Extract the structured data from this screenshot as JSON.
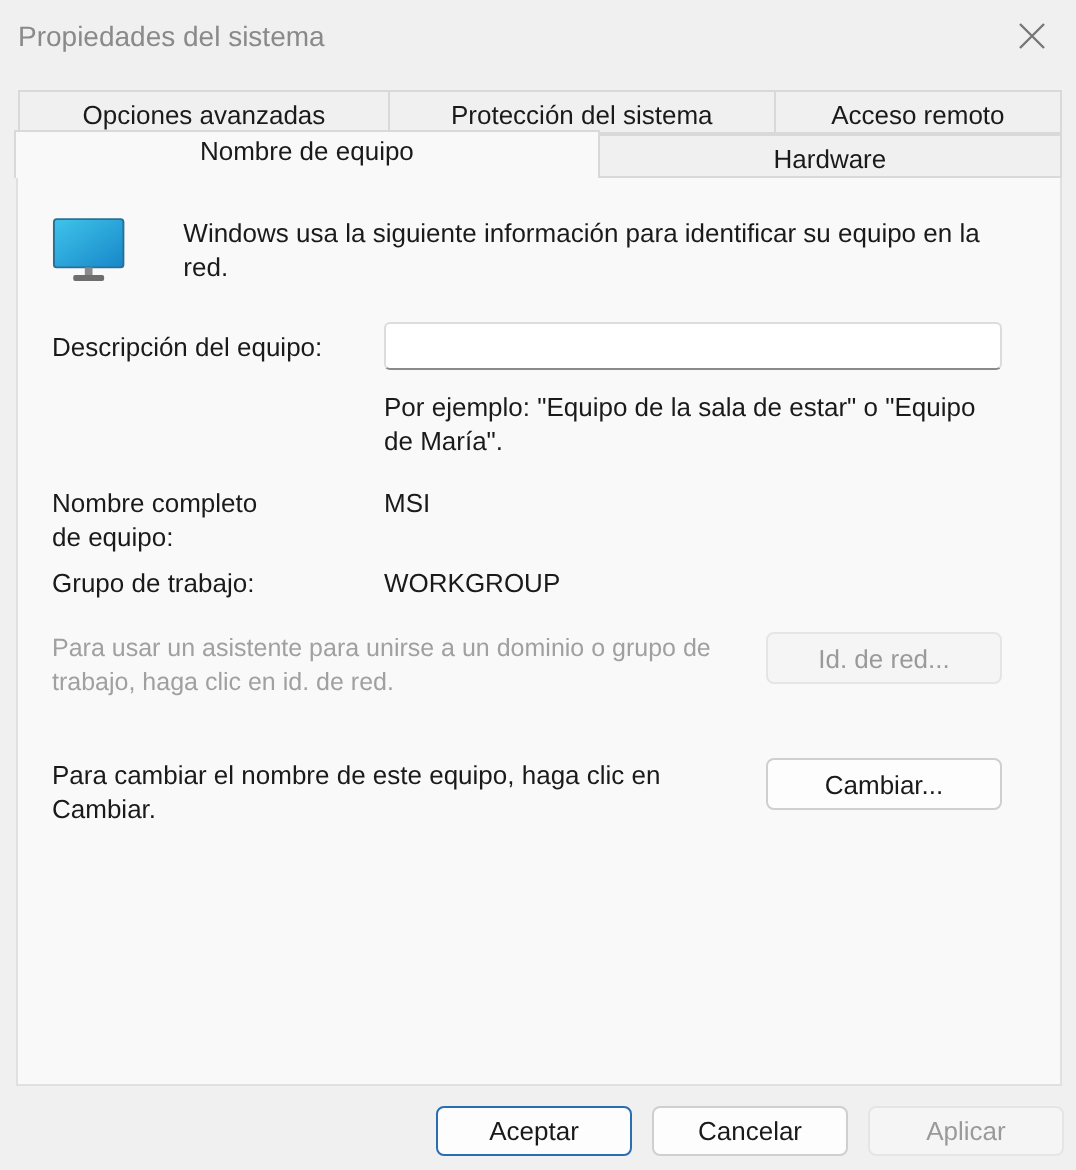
{
  "window": {
    "title": "Propiedades del sistema"
  },
  "tab_rows": [
    {
      "tabs": [
        {
          "label": "Opciones avanzadas",
          "selected": false
        },
        {
          "label": "Protección del sistema",
          "selected": false
        },
        {
          "label": "Acceso remoto",
          "selected": false
        }
      ]
    },
    {
      "tabs": [
        {
          "label": "Nombre de equipo",
          "selected": true
        },
        {
          "label": "Hardware",
          "selected": false
        }
      ]
    }
  ],
  "panel": {
    "intro": "Windows usa la siguiente información para identificar su equipo en la red.",
    "description": {
      "label": "Descripción del equipo:",
      "hint": "Por ejemplo: \"Equipo de la sala de estar\" o \"Equipo de María\"."
    },
    "fields": [
      {
        "label": "Nombre completo de equipo:",
        "value": "MSI"
      },
      {
        "label": "Grupo de trabajo:",
        "value": "WORKGROUP"
      }
    ],
    "actions": [
      {
        "text": "Para usar un asistente para unirse a un dominio o grupo de trabajo, haga clic en id. de red.",
        "button": "Id. de red...",
        "disabled": true
      },
      {
        "text": "Para cambiar el nombre de este equipo, haga clic en Cambiar.",
        "button": "Cambiar...",
        "disabled": false
      }
    ]
  },
  "buttons": [
    {
      "label": "Aceptar",
      "default": true,
      "disabled": false
    },
    {
      "label": "Cancelar",
      "default": false,
      "disabled": false
    },
    {
      "label": "Aplicar",
      "default": false,
      "disabled": true
    }
  ]
}
